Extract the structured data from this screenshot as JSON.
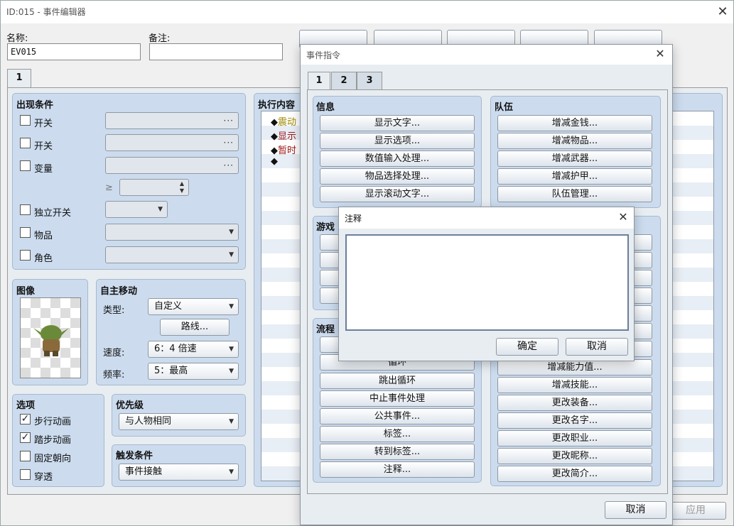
{
  "main_window": {
    "title": "ID:015 - 事件编辑器",
    "name_label": "名称:",
    "name_value": "EV015",
    "note_label": "备注:",
    "note_value": "",
    "page_tab": "1",
    "apply_button": "应用",
    "conditions": {
      "title": "出现条件",
      "switch1_label": "开关",
      "switch2_label": "开关",
      "variable_label": "变量",
      "ge_symbol": "≥",
      "self_switch_label": "独立开关",
      "item_label": "物品",
      "actor_label": "角色"
    },
    "image": {
      "title": "图像"
    },
    "autonomous_movement": {
      "title": "自主移动",
      "type_label": "类型:",
      "type_value": "自定义",
      "route_button": "路线...",
      "speed_label": "速度:",
      "speed_value": "6：4 倍速",
      "freq_label": "频率:",
      "freq_value": "5：最高"
    },
    "options": {
      "title": "选项",
      "items": [
        {
          "label": "步行动画",
          "checked": true,
          "mark": "✓"
        },
        {
          "label": "踏步动画",
          "checked": true,
          "mark": "✓"
        },
        {
          "label": "固定朝向",
          "checked": false,
          "mark": ""
        },
        {
          "label": "穿透",
          "checked": false,
          "mark": ""
        }
      ]
    },
    "priority": {
      "title": "优先级",
      "value": "与人物相同"
    },
    "trigger": {
      "title": "触发条件",
      "value": "事件接触"
    },
    "contents": {
      "title": "执行内容",
      "rows": [
        {
          "bullet": "◆",
          "text": "震动"
        },
        {
          "bullet": "◆",
          "text": "显示"
        },
        {
          "bullet": "◆",
          "text": "暂时"
        },
        {
          "bullet": "◆",
          "text": ""
        }
      ]
    }
  },
  "command_window": {
    "title": "事件指令",
    "tabs": [
      "1",
      "2",
      "3"
    ],
    "info": {
      "title": "信息",
      "buttons": [
        "显示文字...",
        "显示选项...",
        "数值输入处理...",
        "物品选择处理...",
        "显示滚动文字..."
      ]
    },
    "party": {
      "title": "队伍",
      "buttons": [
        "增减金钱...",
        "增减物品...",
        "增减武器...",
        "增减护甲...",
        "队伍管理..."
      ]
    },
    "game": {
      "title": "游戏"
    },
    "flow": {
      "title": "流程",
      "buttons": [
        "循环",
        "跳出循环",
        "中止事件处理",
        "公共事件...",
        "标签...",
        "转到标签...",
        "注释..."
      ]
    },
    "actor": {
      "buttons": [
        "增减能力值...",
        "增减技能...",
        "更改装备...",
        "更改名字...",
        "更改职业...",
        "更改昵称...",
        "更改简介..."
      ]
    },
    "cancel_button": "取消"
  },
  "comment_dialog": {
    "title": "注释",
    "text": "",
    "ok_button": "确定",
    "cancel_button": "取消"
  },
  "icons": {
    "close": "close-icon",
    "dropdown": "chevron-down-icon",
    "ellipsis": "ellipsis-icon",
    "spinner": "spinner-icon"
  }
}
